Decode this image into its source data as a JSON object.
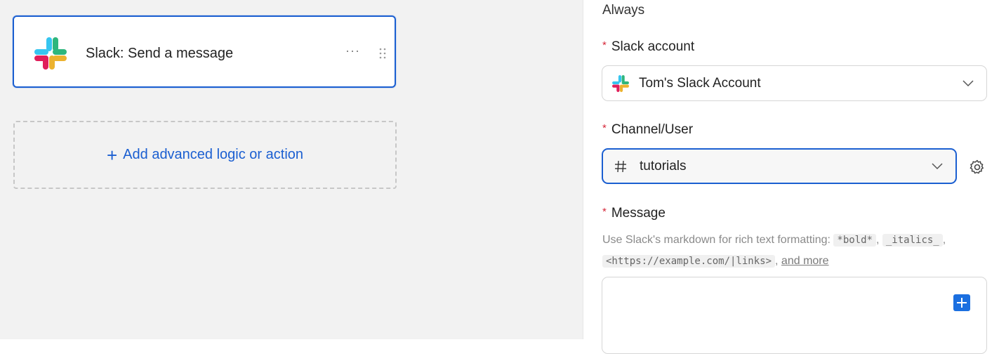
{
  "canvas": {
    "step": {
      "title": "Slack: Send a message",
      "more_label": "···"
    },
    "add_action": {
      "plus": "+",
      "label": "Add advanced logic or action"
    }
  },
  "panel": {
    "trigger_value": "Always",
    "required_marker": "*",
    "slack_account": {
      "label": "Slack account",
      "value": "Tom's Slack Account"
    },
    "channel": {
      "label": "Channel/User",
      "value": "tutorials"
    },
    "message": {
      "label": "Message",
      "help_prefix": "Use Slack's markdown for rich text formatting:",
      "code_bold": "*bold*",
      "code_italics": "_italics_",
      "code_links": "<https://example.com/|links>",
      "sep": ",",
      "more_link": "and more"
    }
  },
  "colors": {
    "accent": "#1b5fd1",
    "required": "#d6283a",
    "canvas_bg": "#f2f2f2"
  },
  "icons": [
    "slack-logo-icon",
    "more-icon",
    "drag-handle-icon",
    "plus-icon",
    "hash-icon",
    "chevron-down-icon",
    "gear-icon",
    "insert-plus-icon"
  ]
}
